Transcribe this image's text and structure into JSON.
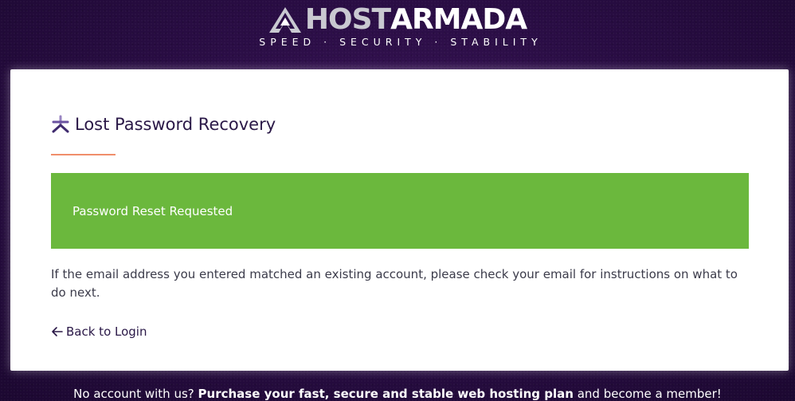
{
  "brand": {
    "logo_host": "HOST",
    "logo_armada": "ARMADA",
    "tagline": "SPEED · SECURITY · STABILITY",
    "logo_icon": "hostarmada-mark-icon"
  },
  "card": {
    "title": "Lost Password Recovery",
    "title_icon": "asterisk-icon",
    "alert": {
      "text": "Password Reset Requested",
      "color": "#6bb83d"
    },
    "message": "If the email address you entered matched an existing account, please check your email for instructions on what to do next.",
    "back_link": {
      "label": "Back to Login",
      "icon": "arrow-left-icon"
    }
  },
  "footer": {
    "prefix": "No account with us?",
    "link_text": "Purchase your fast, secure and stable web hosting plan",
    "suffix": "and become a member!"
  },
  "colors": {
    "background": "#2a0d45",
    "accent_underline": "#f08e6b",
    "title_text": "#2a1847",
    "icon_purple": "#5a3d8a"
  }
}
